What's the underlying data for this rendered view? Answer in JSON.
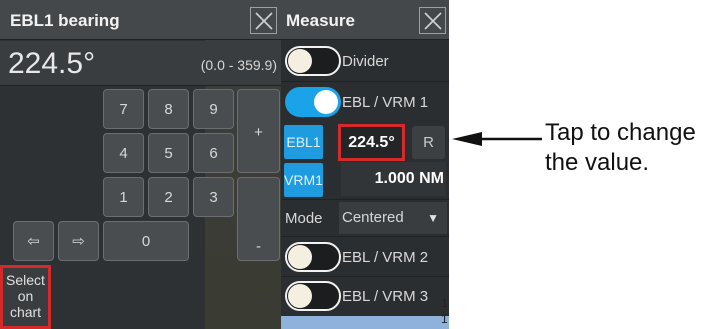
{
  "ebl_panel": {
    "title": "EBL1 bearing",
    "value": "224.5°",
    "range": "(0.0 - 359.9)",
    "keys": {
      "k7": "7",
      "k8": "8",
      "k9": "9",
      "k4": "4",
      "k5": "5",
      "k6": "6",
      "k1": "1",
      "k2": "2",
      "k3": "3",
      "k0": "0",
      "plus": "+",
      "minus": "-",
      "left_arrow": "⇦",
      "right_arrow": "⇨"
    },
    "select_on_chart": [
      "Select",
      "on",
      "chart"
    ]
  },
  "measure_panel": {
    "title": "Measure",
    "divider": {
      "label": "Divider",
      "on": false
    },
    "ebl_vrm1": {
      "label": "EBL / VRM 1",
      "on": true
    },
    "ebl1_button": "EBL1",
    "bearing_value": "224.5°",
    "r_button": "R",
    "vrm1_button": "VRM1",
    "range_value": "1.000 NM",
    "mode_label": "Mode",
    "mode_value": "Centered",
    "ebl_vrm2": {
      "label": "EBL / VRM 2",
      "on": false
    },
    "ebl_vrm3": {
      "label": "EBL / VRM 3",
      "on": false
    },
    "edge_digits": [
      "1",
      "1"
    ]
  },
  "callout": {
    "line1": "Tap to change",
    "line2": "the value."
  },
  "colors": {
    "accent_blue": "#1aa3e8",
    "highlight_red": "#d52a2a",
    "panel_bg": "#2e3134"
  }
}
